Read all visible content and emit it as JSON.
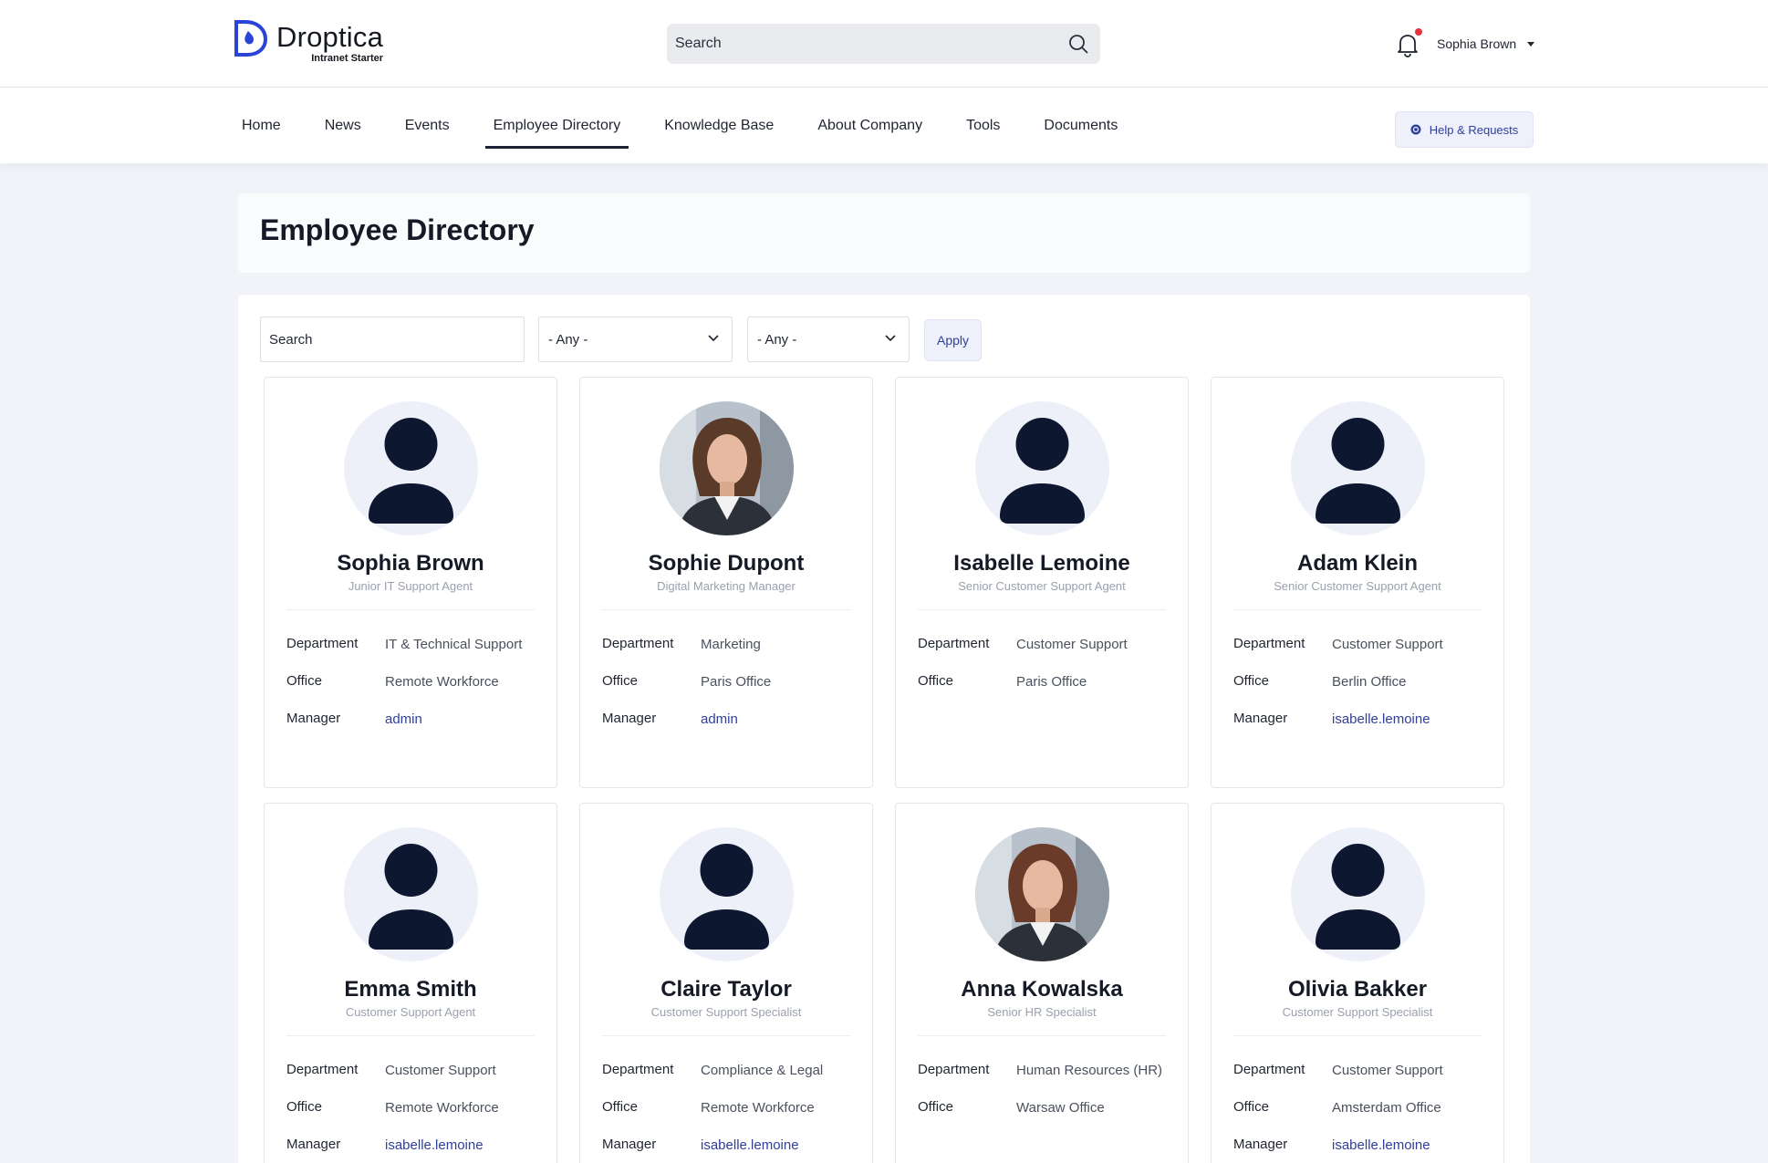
{
  "brand": {
    "name": "Droptica",
    "tagline": "Intranet Starter"
  },
  "header": {
    "search_placeholder": "Search",
    "user_name": "Sophia Brown"
  },
  "nav": {
    "items": [
      "Home",
      "News",
      "Events",
      "Employee Directory",
      "Knowledge Base",
      "About Company",
      "Tools",
      "Documents"
    ],
    "active": "Employee Directory",
    "help_label": "Help & Requests"
  },
  "page": {
    "title": "Employee Directory"
  },
  "filters": {
    "search_placeholder": "Search",
    "select1_value": "- Any -",
    "select2_value": "- Any -",
    "apply_label": "Apply"
  },
  "labels": {
    "department": "Department",
    "office": "Office",
    "manager": "Manager"
  },
  "employees": [
    {
      "name": "Sophia Brown",
      "role": "Junior IT Support Agent",
      "department": "IT & Technical Support",
      "office": "Remote Workforce",
      "manager": "admin",
      "photo": "placeholder-avatar"
    },
    {
      "name": "Sophie Dupont",
      "role": "Digital Marketing Manager",
      "department": "Marketing",
      "office": "Paris Office",
      "manager": "admin",
      "photo": "portrait"
    },
    {
      "name": "Isabelle Lemoine",
      "role": "Senior Customer Support Agent",
      "department": "Customer Support",
      "office": "Paris Office",
      "manager": "",
      "photo": "placeholder-avatar"
    },
    {
      "name": "Adam Klein",
      "role": "Senior Customer Support Agent",
      "department": "Customer Support",
      "office": "Berlin Office",
      "manager": "isabelle.lemoine",
      "photo": "placeholder-avatar"
    },
    {
      "name": "Emma Smith",
      "role": "Customer Support Agent",
      "department": "Customer Support",
      "office": "Remote Workforce",
      "manager": "isabelle.lemoine",
      "photo": "placeholder-avatar"
    },
    {
      "name": "Claire Taylor",
      "role": "Customer Support Specialist",
      "department": "Compliance & Legal",
      "office": "Remote Workforce",
      "manager": "isabelle.lemoine",
      "photo": "placeholder-avatar"
    },
    {
      "name": "Anna Kowalska",
      "role": "Senior HR Specialist",
      "department": "Human Resources (HR)",
      "office": "Warsaw Office",
      "manager": "",
      "photo": "portrait"
    },
    {
      "name": "Olivia Bakker",
      "role": "Customer Support Specialist",
      "department": "Customer Support",
      "office": "Amsterdam Office",
      "manager": "isabelle.lemoine",
      "photo": "placeholder-avatar"
    }
  ],
  "colors": {
    "accent": "#2f3f9a",
    "logo_blue": "#2a44d8",
    "avatar_bg": "#eef0f9",
    "avatar_figure": "#0d1730",
    "notification_dot": "#e8343f"
  }
}
